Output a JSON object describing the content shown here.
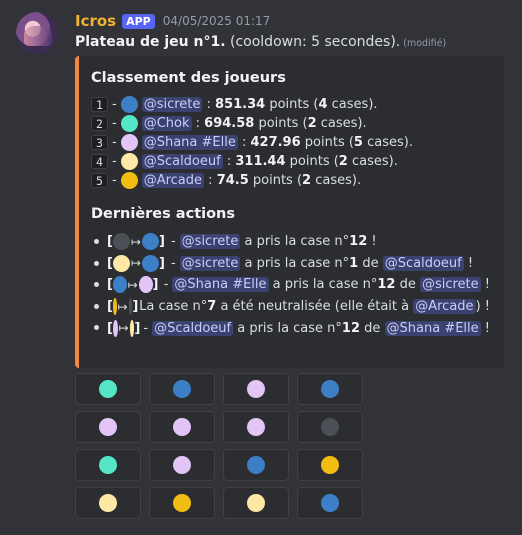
{
  "colors": {
    "blue": "#3c7fc7",
    "teal": "#54e6c6",
    "lavender": "#e2c5f6",
    "cream": "#fde8a6",
    "yellow": "#f2bd12",
    "gray": "#4c4f55"
  },
  "header": {
    "username": "Icros",
    "badge": "APP",
    "timestamp": "04/05/2025 01:17"
  },
  "title": {
    "bold": "Plateau de jeu n°1.",
    "rest": " (cooldown: 5 secondes).",
    "edited": "(modifié)"
  },
  "embed": {
    "ranking_title": "Classement des joueurs",
    "ranking": [
      {
        "rank": "1",
        "color": "blue",
        "mention": "@sicrete",
        "sep": " : ",
        "points": "851.34",
        "points_label": " points (",
        "cases": "4",
        "cases_label": " cases)."
      },
      {
        "rank": "2",
        "color": "teal",
        "mention": "@Chok",
        "sep": " : ",
        "points": "694.58",
        "points_label": " points (",
        "cases": "2",
        "cases_label": " cases)."
      },
      {
        "rank": "3",
        "color": "lavender",
        "mention": "@Shana #Elle",
        "sep": " : ",
        "points": "427.96",
        "points_label": " points (",
        "cases": "5",
        "cases_label": " cases)."
      },
      {
        "rank": "4",
        "color": "cream",
        "mention": "@Scaldoeuf",
        "sep": " : ",
        "points": "311.44",
        "points_label": " points (",
        "cases": "2",
        "cases_label": " cases)."
      },
      {
        "rank": "5",
        "color": "yellow",
        "mention": "@Arcade",
        "sep": " : ",
        "points": "74.5",
        "points_label": " points (",
        "cases": "2",
        "cases_label": " cases)."
      }
    ],
    "dash": "-",
    "actions_title": "Dernières actions",
    "bracket_open": "[",
    "bracket_close": "]",
    "arrow": "↦",
    "actions": [
      {
        "from": "gray",
        "to": "blue",
        "parts": [
          "@sicrete",
          " a pris la case n°",
          "12",
          " !",
          "",
          ""
        ]
      },
      {
        "from": "cream",
        "to": "blue",
        "parts": [
          "@sicrete",
          " a pris la case n°",
          "1",
          " de ",
          "@Scaldoeuf",
          " !"
        ]
      },
      {
        "from": "blue",
        "to": "lavender",
        "parts": [
          "@Shana #Elle",
          " a pris la case n°",
          "12",
          " de ",
          "@sicrete",
          " !"
        ]
      },
      {
        "from": "yellow",
        "to": "gray",
        "neutral": [
          "La case n°",
          "7",
          " a été neutralisée (elle était à ",
          "@Arcade",
          ") !"
        ]
      },
      {
        "from": "lavender",
        "to": "cream",
        "parts": [
          "@Scaldoeuf",
          " a pris la case n°",
          "12",
          " de ",
          "@Shana #Elle",
          " !"
        ]
      }
    ]
  },
  "board": {
    "cells": [
      "teal",
      "blue",
      "lavender",
      "blue",
      "lavender",
      "lavender",
      "lavender",
      "gray",
      "teal",
      "lavender",
      "blue",
      "yellow",
      "cream",
      "yellow",
      "cream",
      "blue"
    ]
  }
}
